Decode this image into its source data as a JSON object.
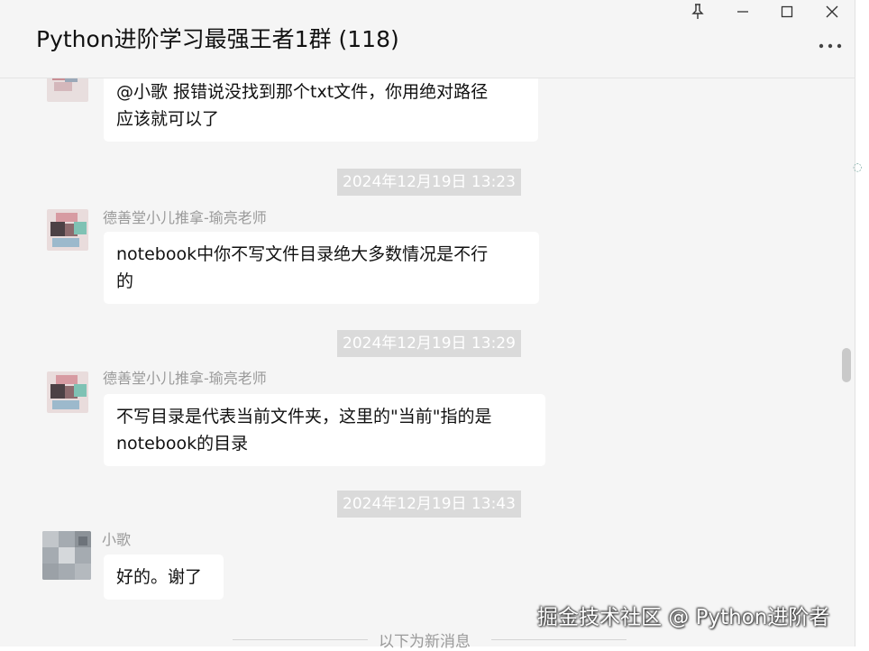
{
  "window": {
    "title": "Python进阶学习最强王者1群 (118)"
  },
  "icons": {
    "pin": "pin-icon",
    "minimize": "minimize-icon",
    "maximize": "maximize-icon",
    "close": "close-icon",
    "more": "more-dots-icon"
  },
  "messages": [
    {
      "sender": "",
      "lines": [
        "@小歌 报错说没找到那个txt文件，你用绝对路径",
        "应该就可以了"
      ]
    },
    {
      "timestamp": "2024年12月19日 13:23",
      "sender": "德善堂小儿推拿-瑜亮老师",
      "lines": [
        "notebook中你不写文件目录绝大多数情况是不行",
        "的"
      ]
    },
    {
      "timestamp": "2024年12月19日 13:29",
      "sender": "德善堂小儿推拿-瑜亮老师",
      "lines": [
        "不写目录是代表当前文件夹，这里的\"当前\"指的是",
        "notebook的目录"
      ]
    },
    {
      "timestamp": "2024年12月19日 13:43",
      "sender": "小歌",
      "lines": [
        "好的。谢了"
      ]
    }
  ],
  "new_messages_label": "以下为新消息",
  "watermark": "掘金技术社区 @ Python进阶者",
  "colors": {
    "background": "#f5f5f5",
    "bubble": "#ffffff",
    "timestamp_bg": "#dadada",
    "sender_text": "#9a9a9a"
  }
}
